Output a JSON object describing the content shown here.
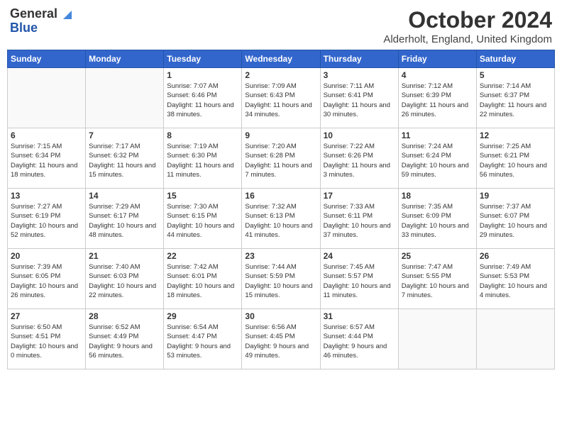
{
  "header": {
    "logo_line1": "General",
    "logo_line2": "Blue",
    "month_title": "October 2024",
    "location": "Alderholt, England, United Kingdom"
  },
  "weekdays": [
    "Sunday",
    "Monday",
    "Tuesday",
    "Wednesday",
    "Thursday",
    "Friday",
    "Saturday"
  ],
  "weeks": [
    [
      {
        "day": "",
        "info": ""
      },
      {
        "day": "",
        "info": ""
      },
      {
        "day": "1",
        "info": "Sunrise: 7:07 AM\nSunset: 6:46 PM\nDaylight: 11 hours and 38 minutes."
      },
      {
        "day": "2",
        "info": "Sunrise: 7:09 AM\nSunset: 6:43 PM\nDaylight: 11 hours and 34 minutes."
      },
      {
        "day": "3",
        "info": "Sunrise: 7:11 AM\nSunset: 6:41 PM\nDaylight: 11 hours and 30 minutes."
      },
      {
        "day": "4",
        "info": "Sunrise: 7:12 AM\nSunset: 6:39 PM\nDaylight: 11 hours and 26 minutes."
      },
      {
        "day": "5",
        "info": "Sunrise: 7:14 AM\nSunset: 6:37 PM\nDaylight: 11 hours and 22 minutes."
      }
    ],
    [
      {
        "day": "6",
        "info": "Sunrise: 7:15 AM\nSunset: 6:34 PM\nDaylight: 11 hours and 18 minutes."
      },
      {
        "day": "7",
        "info": "Sunrise: 7:17 AM\nSunset: 6:32 PM\nDaylight: 11 hours and 15 minutes."
      },
      {
        "day": "8",
        "info": "Sunrise: 7:19 AM\nSunset: 6:30 PM\nDaylight: 11 hours and 11 minutes."
      },
      {
        "day": "9",
        "info": "Sunrise: 7:20 AM\nSunset: 6:28 PM\nDaylight: 11 hours and 7 minutes."
      },
      {
        "day": "10",
        "info": "Sunrise: 7:22 AM\nSunset: 6:26 PM\nDaylight: 11 hours and 3 minutes."
      },
      {
        "day": "11",
        "info": "Sunrise: 7:24 AM\nSunset: 6:24 PM\nDaylight: 10 hours and 59 minutes."
      },
      {
        "day": "12",
        "info": "Sunrise: 7:25 AM\nSunset: 6:21 PM\nDaylight: 10 hours and 56 minutes."
      }
    ],
    [
      {
        "day": "13",
        "info": "Sunrise: 7:27 AM\nSunset: 6:19 PM\nDaylight: 10 hours and 52 minutes."
      },
      {
        "day": "14",
        "info": "Sunrise: 7:29 AM\nSunset: 6:17 PM\nDaylight: 10 hours and 48 minutes."
      },
      {
        "day": "15",
        "info": "Sunrise: 7:30 AM\nSunset: 6:15 PM\nDaylight: 10 hours and 44 minutes."
      },
      {
        "day": "16",
        "info": "Sunrise: 7:32 AM\nSunset: 6:13 PM\nDaylight: 10 hours and 41 minutes."
      },
      {
        "day": "17",
        "info": "Sunrise: 7:33 AM\nSunset: 6:11 PM\nDaylight: 10 hours and 37 minutes."
      },
      {
        "day": "18",
        "info": "Sunrise: 7:35 AM\nSunset: 6:09 PM\nDaylight: 10 hours and 33 minutes."
      },
      {
        "day": "19",
        "info": "Sunrise: 7:37 AM\nSunset: 6:07 PM\nDaylight: 10 hours and 29 minutes."
      }
    ],
    [
      {
        "day": "20",
        "info": "Sunrise: 7:39 AM\nSunset: 6:05 PM\nDaylight: 10 hours and 26 minutes."
      },
      {
        "day": "21",
        "info": "Sunrise: 7:40 AM\nSunset: 6:03 PM\nDaylight: 10 hours and 22 minutes."
      },
      {
        "day": "22",
        "info": "Sunrise: 7:42 AM\nSunset: 6:01 PM\nDaylight: 10 hours and 18 minutes."
      },
      {
        "day": "23",
        "info": "Sunrise: 7:44 AM\nSunset: 5:59 PM\nDaylight: 10 hours and 15 minutes."
      },
      {
        "day": "24",
        "info": "Sunrise: 7:45 AM\nSunset: 5:57 PM\nDaylight: 10 hours and 11 minutes."
      },
      {
        "day": "25",
        "info": "Sunrise: 7:47 AM\nSunset: 5:55 PM\nDaylight: 10 hours and 7 minutes."
      },
      {
        "day": "26",
        "info": "Sunrise: 7:49 AM\nSunset: 5:53 PM\nDaylight: 10 hours and 4 minutes."
      }
    ],
    [
      {
        "day": "27",
        "info": "Sunrise: 6:50 AM\nSunset: 4:51 PM\nDaylight: 10 hours and 0 minutes."
      },
      {
        "day": "28",
        "info": "Sunrise: 6:52 AM\nSunset: 4:49 PM\nDaylight: 9 hours and 56 minutes."
      },
      {
        "day": "29",
        "info": "Sunrise: 6:54 AM\nSunset: 4:47 PM\nDaylight: 9 hours and 53 minutes."
      },
      {
        "day": "30",
        "info": "Sunrise: 6:56 AM\nSunset: 4:45 PM\nDaylight: 9 hours and 49 minutes."
      },
      {
        "day": "31",
        "info": "Sunrise: 6:57 AM\nSunset: 4:44 PM\nDaylight: 9 hours and 46 minutes."
      },
      {
        "day": "",
        "info": ""
      },
      {
        "day": "",
        "info": ""
      }
    ]
  ]
}
